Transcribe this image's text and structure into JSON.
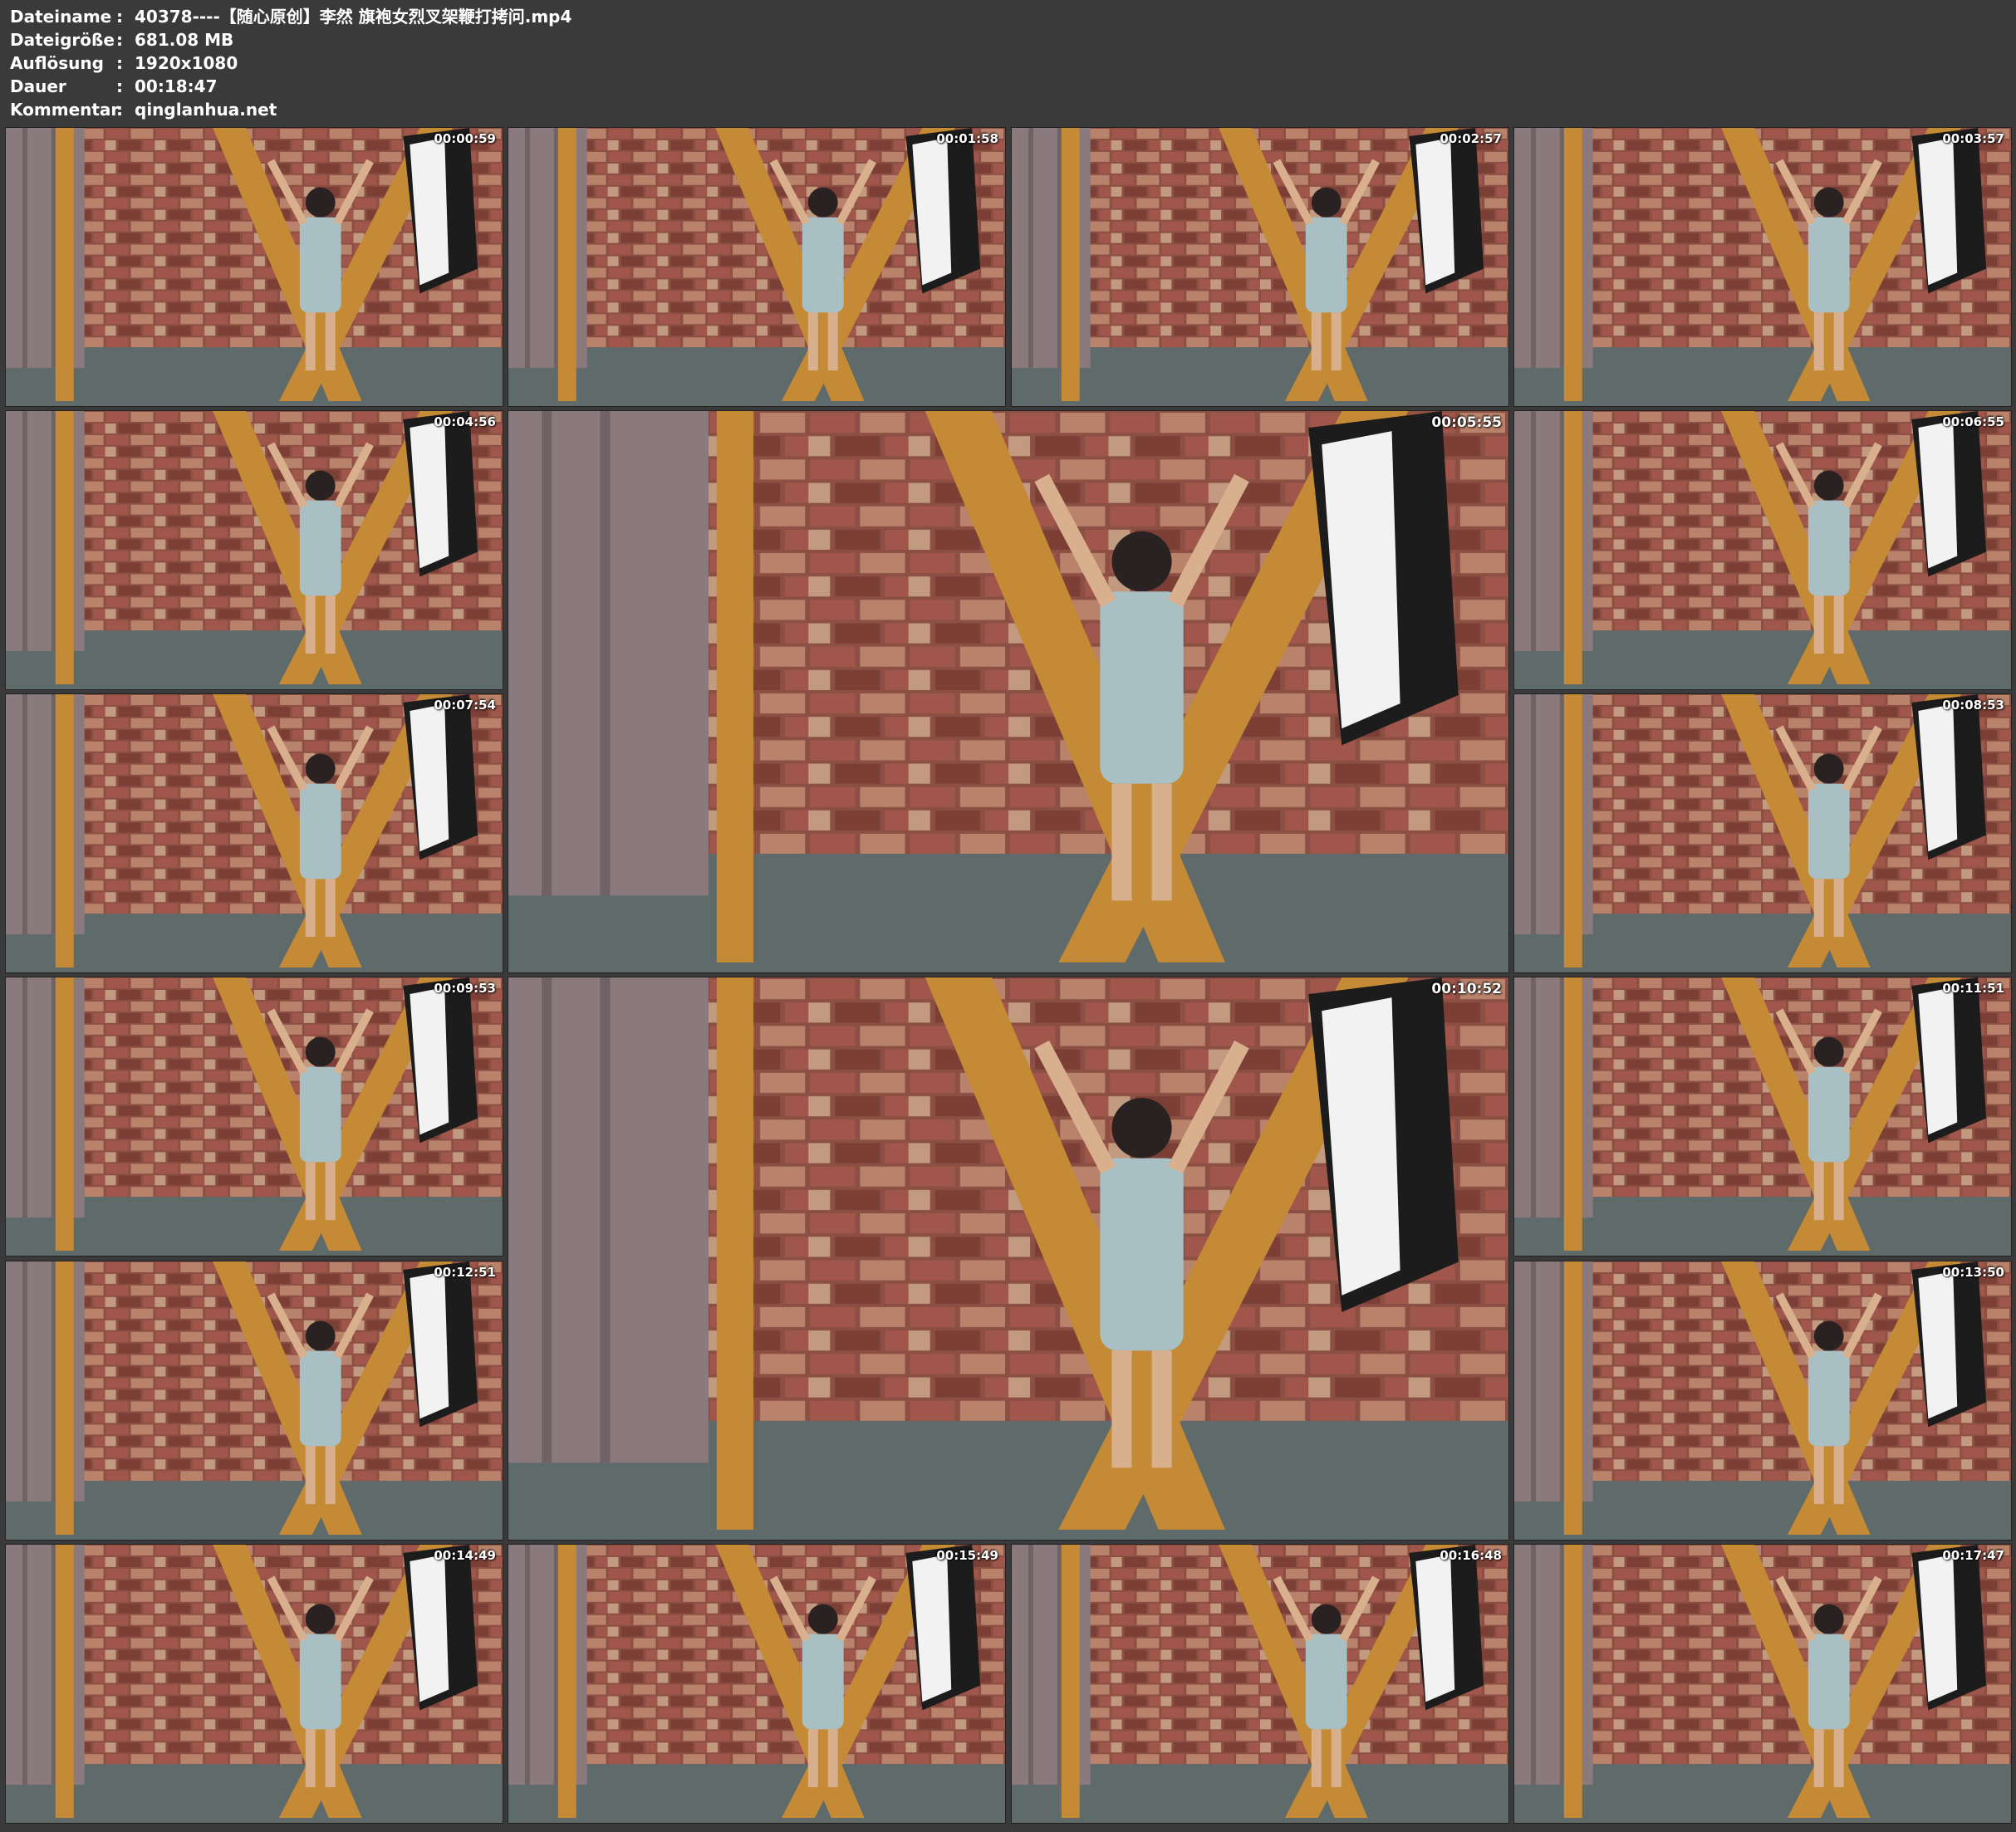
{
  "info": {
    "rows": [
      {
        "key": "Dateiname",
        "value": "40378----【随心原创】李然 旗袍女烈叉架鞭打拷问.mp4"
      },
      {
        "key": "Dateigröße",
        "value": "681.08 MB"
      },
      {
        "key": "Auflösung",
        "value": "1920x1080"
      },
      {
        "key": "Dauer",
        "value": "00:18:47"
      },
      {
        "key": "Kommentar",
        "value": "qinglanhua.net"
      }
    ],
    "separator": ":"
  },
  "thumbnails": [
    {
      "time": "00:00:59"
    },
    {
      "time": "00:01:58"
    },
    {
      "time": "00:02:57"
    },
    {
      "time": "00:03:57"
    },
    {
      "time": "00:04:56"
    },
    {
      "time": "00:05:55"
    },
    {
      "time": "00:06:55"
    },
    {
      "time": "00:07:54"
    },
    {
      "time": "00:08:53"
    },
    {
      "time": "00:09:53"
    },
    {
      "time": "00:10:52"
    },
    {
      "time": "00:11:51"
    },
    {
      "time": "00:12:51"
    },
    {
      "time": "00:13:50"
    },
    {
      "time": "00:14:49"
    },
    {
      "time": "00:15:49"
    },
    {
      "time": "00:16:48"
    },
    {
      "time": "00:17:47"
    }
  ],
  "colors": {
    "background": "#3a3a3a",
    "brick": "#8c4f43",
    "wood": "#c48a35",
    "curtain": "#8a7a7e",
    "floor": "#5f6a6a"
  }
}
